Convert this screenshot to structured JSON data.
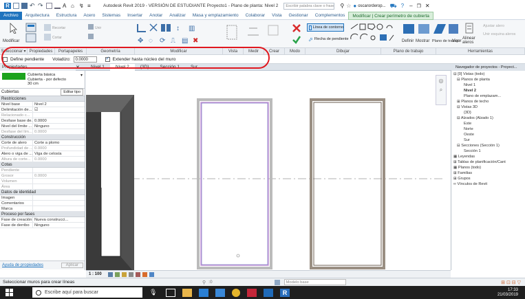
{
  "titlebar": {
    "title": "Autodesk Revit 2019 - VERSIÓN DE ESTUDIANTE   Proyecto1 - Plano de planta: Nivel 2",
    "search_placeholder": "Escribir palabra clave o frase",
    "user": "oscarorderop..."
  },
  "tabs": [
    {
      "label": "Archivo",
      "active": true
    },
    {
      "label": "Arquitectura"
    },
    {
      "label": "Estructura"
    },
    {
      "label": "Acero"
    },
    {
      "label": "Sistemas"
    },
    {
      "label": "Insertar"
    },
    {
      "label": "Anotar"
    },
    {
      "label": "Analizar"
    },
    {
      "label": "Masa y emplazamiento"
    },
    {
      "label": "Colaborar"
    },
    {
      "label": "Vista"
    },
    {
      "label": "Gestionar"
    },
    {
      "label": "Complementos"
    },
    {
      "label": "Modificar | Crear perímetro de cubierta",
      "ctx": true
    }
  ],
  "ribbon": {
    "modify": "Modificar",
    "line_label": "Línea de contorno",
    "slope_label": "Flecha de pendiente",
    "set": "Definir",
    "show": "Mostrar",
    "work_plane": "Plano de trabajo",
    "viewer": "Visor",
    "align_eaves": "Alinear aleros",
    "adjust": "Ajustar alero",
    "join": "Unir esquina aleros"
  },
  "groups": [
    "Seleccionar ▾",
    "Propiedades",
    "Portapapeles",
    "Geometría",
    "Modificar",
    "Vista",
    "Medir",
    "Crear",
    "Modo",
    "Dibujar",
    "Plano de trabajo",
    "Herramientas"
  ],
  "options": {
    "slope_label": "Define pendiente",
    "overhang_label": "Voladizo:",
    "overhang_value": "0.0000",
    "extend_label": "Extender hasta núcleo del muro"
  },
  "viewtabs": {
    "props": "Propiedades",
    "tabs": [
      "Nivel 1",
      "Nivel 2",
      "{3D}",
      "Sección 1",
      "Sur"
    ]
  },
  "properties": {
    "type_name": "Cubierta básica",
    "type_sub": "Cubierta - por defecto",
    "type_size": "30 cm",
    "category": "Cubiertas",
    "edit_type": "Editar tipo",
    "sections": [
      {
        "head": "Restricciones",
        "rows": [
          [
            "Nivel base",
            "Nivel 2"
          ],
          [
            "Delimitación de...",
            "☑"
          ],
          [
            "Relacionado c...",
            ""
          ],
          [
            "Desfase base de...",
            "0.0000"
          ],
          [
            "Nivel del límite ...",
            "Ninguno"
          ],
          [
            "Desfase del lím...",
            "0.0000"
          ]
        ]
      },
      {
        "head": "Construcción",
        "rows": [
          [
            "Corte de alero",
            "Corte a plomo"
          ],
          [
            "Profundidad de ...",
            "0.0000"
          ],
          [
            "Alero o viga de ...",
            "Viga de celosía"
          ],
          [
            "Altura de corte...",
            "0.0000"
          ]
        ]
      },
      {
        "head": "Cotas",
        "rows": [
          [
            "Pendiente",
            ""
          ],
          [
            "Grosor",
            "0.0000"
          ],
          [
            "Volumen",
            ""
          ],
          [
            "Área",
            ""
          ]
        ]
      },
      {
        "head": "Datos de identidad",
        "rows": [
          [
            "Imagen",
            ""
          ],
          [
            "Comentarios",
            ""
          ],
          [
            "Marca",
            ""
          ]
        ]
      },
      {
        "head": "Proceso por fases",
        "rows": [
          [
            "Fase de creación",
            "Nueva construcci..."
          ],
          [
            "Fase de derribo",
            "Ninguno"
          ]
        ]
      }
    ],
    "help": "Ayuda de propiedades",
    "apply": "Aplicar"
  },
  "browser": {
    "title": "Navegador de proyectos - Proyect...",
    "items": [
      {
        "t": "⊟ [0] Vistas (todo)",
        "d": 0
      },
      {
        "t": "⊟ Planos de planta",
        "d": 1
      },
      {
        "t": "Nivel 1",
        "d": 3
      },
      {
        "t": "Nivel 2",
        "d": 3,
        "b": true
      },
      {
        "t": "Plano de emplazam...",
        "d": 3
      },
      {
        "t": "⊞ Planos de techo",
        "d": 1
      },
      {
        "t": "⊟ Vistas 3D",
        "d": 1
      },
      {
        "t": "{3D}",
        "d": 3
      },
      {
        "t": "⊟ Alzados (Alzado 1)",
        "d": 1
      },
      {
        "t": "Este",
        "d": 3
      },
      {
        "t": "Norte",
        "d": 3
      },
      {
        "t": "Oeste",
        "d": 3
      },
      {
        "t": "Sur",
        "d": 3
      },
      {
        "t": "⊟ Secciones (Sección 1)",
        "d": 1
      },
      {
        "t": "Sección 1",
        "d": 3
      },
      {
        "t": "▦ Leyendas",
        "d": 0
      },
      {
        "t": "⊞ Tablas de planificación/Cant",
        "d": 0
      },
      {
        "t": "▦ Planos (todo)",
        "d": 0
      },
      {
        "t": "⊞ Familias",
        "d": 0
      },
      {
        "t": "⊞ Grupos",
        "d": 0
      },
      {
        "t": "∞ Vínculos de Revit",
        "d": 0
      }
    ]
  },
  "viewctrl": {
    "scale": "1 : 100"
  },
  "status": {
    "message": "Seleccionar muros para crear líneas",
    "zero": ":0",
    "model": "Modelo base"
  },
  "taskbar": {
    "search": "Escribe aquí para buscar",
    "time": "17:33",
    "date": "21/03/2019"
  },
  "colors": {
    "accent": "#1e73be",
    "highlight": "#e0181f",
    "type_swatch": "#1da31d"
  }
}
